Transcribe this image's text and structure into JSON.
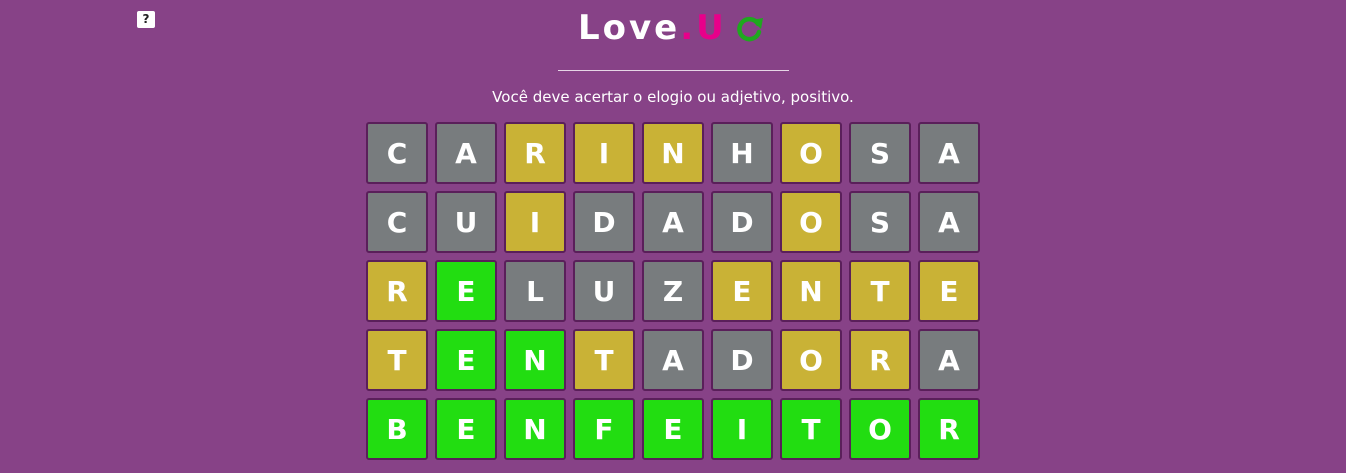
{
  "help": {
    "label": "?"
  },
  "header": {
    "title_main": "Love",
    "title_dot": ".",
    "title_accent": "U",
    "reload_icon": "reload-icon",
    "accent_color": "#e8008a",
    "reload_color": "#1fa81f"
  },
  "instructions": "Você deve acertar o elogio ou adjetivo, positivo.",
  "colors": {
    "background": "#874287",
    "absent": "#787c7e",
    "present": "#c9b236",
    "correct": "#22dd11"
  },
  "board": {
    "rows": [
      {
        "letters": [
          "C",
          "A",
          "R",
          "I",
          "N",
          "H",
          "O",
          "S",
          "A"
        ],
        "states": [
          "absent",
          "absent",
          "present",
          "present",
          "present",
          "absent",
          "present",
          "absent",
          "absent"
        ]
      },
      {
        "letters": [
          "C",
          "U",
          "I",
          "D",
          "A",
          "D",
          "O",
          "S",
          "A"
        ],
        "states": [
          "absent",
          "absent",
          "present",
          "absent",
          "absent",
          "absent",
          "present",
          "absent",
          "absent"
        ]
      },
      {
        "letters": [
          "R",
          "E",
          "L",
          "U",
          "Z",
          "E",
          "N",
          "T",
          "E"
        ],
        "states": [
          "present",
          "correct",
          "absent",
          "absent",
          "absent",
          "present",
          "present",
          "present",
          "present"
        ]
      },
      {
        "letters": [
          "T",
          "E",
          "N",
          "T",
          "A",
          "D",
          "O",
          "R",
          "A"
        ],
        "states": [
          "present",
          "correct",
          "correct",
          "present",
          "absent",
          "absent",
          "present",
          "present",
          "absent"
        ]
      },
      {
        "letters": [
          "B",
          "E",
          "N",
          "F",
          "E",
          "I",
          "T",
          "O",
          "R"
        ],
        "states": [
          "correct",
          "correct",
          "correct",
          "correct",
          "correct",
          "correct",
          "correct",
          "correct",
          "correct"
        ]
      }
    ]
  }
}
